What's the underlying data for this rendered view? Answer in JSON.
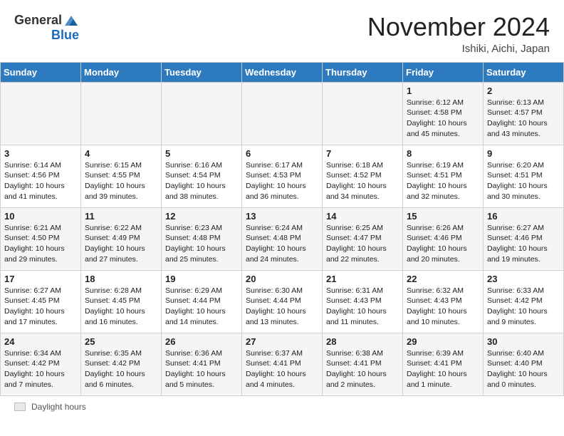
{
  "header": {
    "logo_general": "General",
    "logo_blue": "Blue",
    "month_title": "November 2024",
    "location": "Ishiki, Aichi, Japan"
  },
  "footer": {
    "label": "Daylight hours"
  },
  "calendar": {
    "days_of_week": [
      "Sunday",
      "Monday",
      "Tuesday",
      "Wednesday",
      "Thursday",
      "Friday",
      "Saturday"
    ],
    "weeks": [
      [
        {
          "day": "",
          "info": ""
        },
        {
          "day": "",
          "info": ""
        },
        {
          "day": "",
          "info": ""
        },
        {
          "day": "",
          "info": ""
        },
        {
          "day": "",
          "info": ""
        },
        {
          "day": "1",
          "info": "Sunrise: 6:12 AM\nSunset: 4:58 PM\nDaylight: 10 hours\nand 45 minutes."
        },
        {
          "day": "2",
          "info": "Sunrise: 6:13 AM\nSunset: 4:57 PM\nDaylight: 10 hours\nand 43 minutes."
        }
      ],
      [
        {
          "day": "3",
          "info": "Sunrise: 6:14 AM\nSunset: 4:56 PM\nDaylight: 10 hours\nand 41 minutes."
        },
        {
          "day": "4",
          "info": "Sunrise: 6:15 AM\nSunset: 4:55 PM\nDaylight: 10 hours\nand 39 minutes."
        },
        {
          "day": "5",
          "info": "Sunrise: 6:16 AM\nSunset: 4:54 PM\nDaylight: 10 hours\nand 38 minutes."
        },
        {
          "day": "6",
          "info": "Sunrise: 6:17 AM\nSunset: 4:53 PM\nDaylight: 10 hours\nand 36 minutes."
        },
        {
          "day": "7",
          "info": "Sunrise: 6:18 AM\nSunset: 4:52 PM\nDaylight: 10 hours\nand 34 minutes."
        },
        {
          "day": "8",
          "info": "Sunrise: 6:19 AM\nSunset: 4:51 PM\nDaylight: 10 hours\nand 32 minutes."
        },
        {
          "day": "9",
          "info": "Sunrise: 6:20 AM\nSunset: 4:51 PM\nDaylight: 10 hours\nand 30 minutes."
        }
      ],
      [
        {
          "day": "10",
          "info": "Sunrise: 6:21 AM\nSunset: 4:50 PM\nDaylight: 10 hours\nand 29 minutes."
        },
        {
          "day": "11",
          "info": "Sunrise: 6:22 AM\nSunset: 4:49 PM\nDaylight: 10 hours\nand 27 minutes."
        },
        {
          "day": "12",
          "info": "Sunrise: 6:23 AM\nSunset: 4:48 PM\nDaylight: 10 hours\nand 25 minutes."
        },
        {
          "day": "13",
          "info": "Sunrise: 6:24 AM\nSunset: 4:48 PM\nDaylight: 10 hours\nand 24 minutes."
        },
        {
          "day": "14",
          "info": "Sunrise: 6:25 AM\nSunset: 4:47 PM\nDaylight: 10 hours\nand 22 minutes."
        },
        {
          "day": "15",
          "info": "Sunrise: 6:26 AM\nSunset: 4:46 PM\nDaylight: 10 hours\nand 20 minutes."
        },
        {
          "day": "16",
          "info": "Sunrise: 6:27 AM\nSunset: 4:46 PM\nDaylight: 10 hours\nand 19 minutes."
        }
      ],
      [
        {
          "day": "17",
          "info": "Sunrise: 6:27 AM\nSunset: 4:45 PM\nDaylight: 10 hours\nand 17 minutes."
        },
        {
          "day": "18",
          "info": "Sunrise: 6:28 AM\nSunset: 4:45 PM\nDaylight: 10 hours\nand 16 minutes."
        },
        {
          "day": "19",
          "info": "Sunrise: 6:29 AM\nSunset: 4:44 PM\nDaylight: 10 hours\nand 14 minutes."
        },
        {
          "day": "20",
          "info": "Sunrise: 6:30 AM\nSunset: 4:44 PM\nDaylight: 10 hours\nand 13 minutes."
        },
        {
          "day": "21",
          "info": "Sunrise: 6:31 AM\nSunset: 4:43 PM\nDaylight: 10 hours\nand 11 minutes."
        },
        {
          "day": "22",
          "info": "Sunrise: 6:32 AM\nSunset: 4:43 PM\nDaylight: 10 hours\nand 10 minutes."
        },
        {
          "day": "23",
          "info": "Sunrise: 6:33 AM\nSunset: 4:42 PM\nDaylight: 10 hours\nand 9 minutes."
        }
      ],
      [
        {
          "day": "24",
          "info": "Sunrise: 6:34 AM\nSunset: 4:42 PM\nDaylight: 10 hours\nand 7 minutes."
        },
        {
          "day": "25",
          "info": "Sunrise: 6:35 AM\nSunset: 4:42 PM\nDaylight: 10 hours\nand 6 minutes."
        },
        {
          "day": "26",
          "info": "Sunrise: 6:36 AM\nSunset: 4:41 PM\nDaylight: 10 hours\nand 5 minutes."
        },
        {
          "day": "27",
          "info": "Sunrise: 6:37 AM\nSunset: 4:41 PM\nDaylight: 10 hours\nand 4 minutes."
        },
        {
          "day": "28",
          "info": "Sunrise: 6:38 AM\nSunset: 4:41 PM\nDaylight: 10 hours\nand 2 minutes."
        },
        {
          "day": "29",
          "info": "Sunrise: 6:39 AM\nSunset: 4:41 PM\nDaylight: 10 hours\nand 1 minute."
        },
        {
          "day": "30",
          "info": "Sunrise: 6:40 AM\nSunset: 4:40 PM\nDaylight: 10 hours\nand 0 minutes."
        }
      ]
    ]
  }
}
